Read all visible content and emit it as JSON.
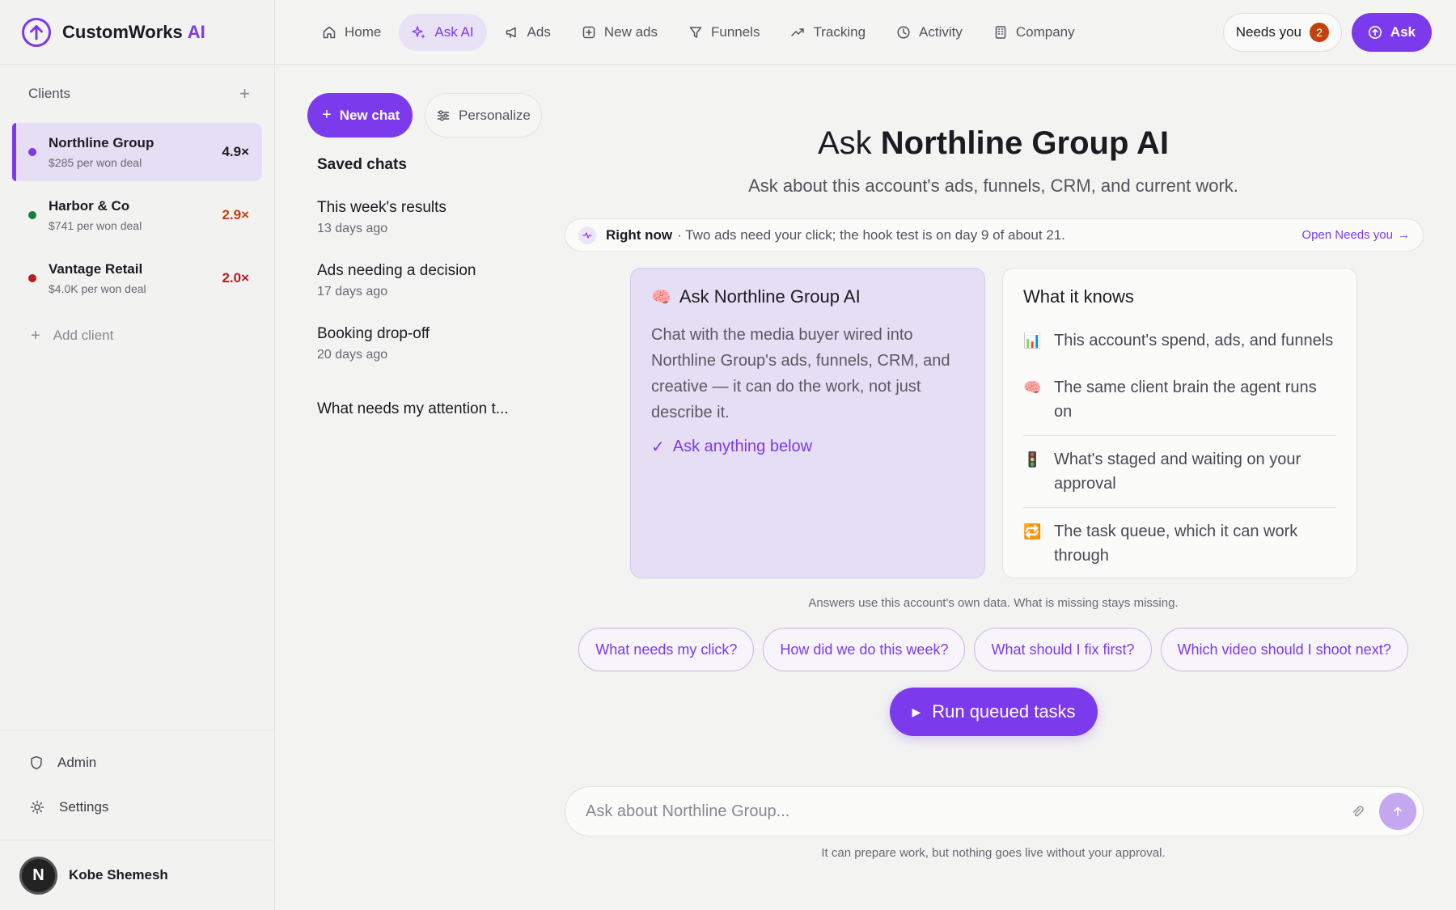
{
  "brand": {
    "name": "CustomWorks",
    "ai": "AI"
  },
  "sidebar": {
    "clients_label": "Clients",
    "clients": [
      {
        "name": "Northline Group",
        "sub": "$285 per won deal",
        "mult": "4.9×",
        "dot": "#7c3aed",
        "mult_color": "#1d1b22",
        "active": true
      },
      {
        "name": "Harbor & Co",
        "sub": "$741 per won deal",
        "mult": "2.9×",
        "dot": "#15803d",
        "mult_color": "#c2410c"
      },
      {
        "name": "Vantage Retail",
        "sub": "$4.0K per won deal",
        "mult": "2.0×",
        "dot": "#b91c1c",
        "mult_color": "#b91c1c"
      }
    ],
    "add_client": "Add client",
    "admin": "Admin",
    "settings": "Settings",
    "user": {
      "initial": "N",
      "name": "Kobe Shemesh"
    }
  },
  "nav": {
    "items": [
      {
        "label": "Home",
        "icon": "home-icon"
      },
      {
        "label": "Ask AI",
        "icon": "sparkle-icon",
        "active": true
      },
      {
        "label": "Ads",
        "icon": "megaphone-icon"
      },
      {
        "label": "New ads",
        "icon": "plus-square-icon"
      },
      {
        "label": "Funnels",
        "icon": "funnel-icon"
      },
      {
        "label": "Tracking",
        "icon": "trend-icon"
      },
      {
        "label": "Activity",
        "icon": "clock-icon"
      },
      {
        "label": "Company",
        "icon": "building-icon"
      }
    ],
    "needs_you": "Needs you",
    "needs_you_count": "2",
    "ask": "Ask"
  },
  "chats": {
    "new_chat": "New chat",
    "personalize": "Personalize",
    "saved_title": "Saved chats",
    "saved": [
      {
        "title": "This week's results",
        "date": "13 days ago"
      },
      {
        "title": "Ads needing a decision",
        "date": "17 days ago"
      },
      {
        "title": "Booking drop-off",
        "date": "20 days ago"
      },
      {
        "title": "What needs my attention t...",
        "date": ""
      }
    ]
  },
  "main": {
    "title_prefix": "Ask",
    "title_bold": "Northline Group AI",
    "subtitle": "Ask about this account's ads, funnels, CRM, and current work.",
    "right_now_label": "Right now",
    "right_now_text": "· Two ads need your click; the hook test is on day 9 of about 21.",
    "open_needs": "Open Needs you",
    "ask_card": {
      "emoji": "🧠",
      "title": "Ask Northline Group AI",
      "body": "Chat with the media buyer wired into Northline Group's ads, funnels, CRM, and creative — it can do the work, not just describe it.",
      "cta": "Ask anything below"
    },
    "knows_card": {
      "title": "What it knows",
      "items": [
        {
          "emoji": "📊",
          "text": "This account's spend, ads, and funnels"
        },
        {
          "emoji": "🧠",
          "text": "The same client brain the agent runs on"
        },
        {
          "emoji": "🚦",
          "text": "What's staged and waiting on your approval"
        },
        {
          "emoji": "🔁",
          "text": "The task queue, which it can work through"
        }
      ]
    },
    "answers_note": "Answers use this account's own data. What is missing stays missing.",
    "suggestions": [
      "What needs my click?",
      "How did we do this week?",
      "What should I fix first?",
      "Which video should I shoot next?"
    ],
    "run_button": "Run queued tasks",
    "composer_placeholder": "Ask about Northline Group...",
    "footer_note": "It can prepare work, but nothing goes live without your approval."
  }
}
